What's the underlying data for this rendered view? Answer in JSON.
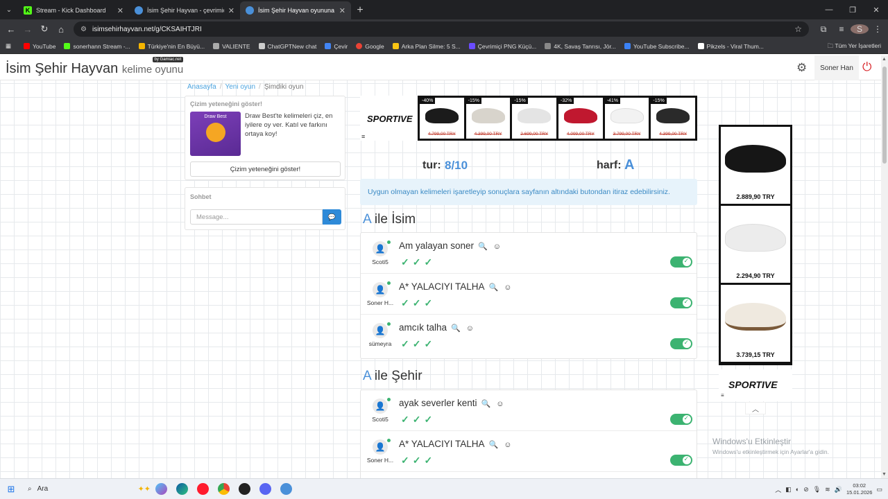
{
  "browser": {
    "tabs": [
      {
        "title": "Stream - Kick Dashboard",
        "icon": "kick-icon",
        "active": false
      },
      {
        "title": "İsim Şehir Hayvan - çevrimiçi oy",
        "icon": "globe-icon",
        "active": false
      },
      {
        "title": "İsim Şehir Hayvan oyununa katı",
        "icon": "globe-icon",
        "active": true
      }
    ],
    "url": "isimsehirhayvan.net/g/CKSAIHTJRI",
    "profile_initial": "S",
    "bookmarks": [
      {
        "label": "YouTube",
        "color": "#ff0000"
      },
      {
        "label": "sonerhann Stream -...",
        "color": "#53fc18"
      },
      {
        "label": "Türkiye'nin En Büyü...",
        "color": "#f4b400"
      },
      {
        "label": "VALIENTE",
        "color": "#aaaaaa"
      },
      {
        "label": "ChatGPTNew chat",
        "color": "#cccccc"
      },
      {
        "label": "Çevir",
        "color": "#4285f4"
      },
      {
        "label": "Google",
        "color": "#ea4335"
      },
      {
        "label": "Arka Plan Silme: 5 S...",
        "color": "#f9c513"
      },
      {
        "label": "Çevrimiçi PNG Küçü...",
        "color": "#6a4cff"
      },
      {
        "label": "4K, Savaş Tanrısı, Jör...",
        "color": "#888888"
      },
      {
        "label": "YouTube Subscribe...",
        "color": "#3b82f6"
      },
      {
        "label": "Pikzels - Viral Thum...",
        "color": "#ffffff"
      }
    ],
    "all_bookmarks": "Tüm Yer İşaretleri"
  },
  "site": {
    "logo": "İsim Şehir Hayvan",
    "logo_sub": "kelime oyunu",
    "logo_badge": "by Gamiac.net",
    "username": "Soner Han"
  },
  "breadcrumb": [
    "Anasayfa",
    "Yeni oyun",
    "Şimdiki oyun"
  ],
  "draw_panel": {
    "title": "Çizim yeteneğini göster!",
    "image_text": "Draw Best",
    "text": "Draw Best'te kelimeleri çiz, en iyilere oy ver. Katıl ve farkını ortaya koy!",
    "button": "Çizim yeteneğini göster!"
  },
  "chat_panel": {
    "title": "Sohbet",
    "placeholder": "Message..."
  },
  "ad_banner": {
    "brand": "SPORTIVE",
    "items": [
      {
        "discount": "-40%",
        "price": "4.799,00 TRY",
        "shoe_color": "#1b1b1b"
      },
      {
        "discount": "-15%",
        "price": "4.399,00 TRY",
        "shoe_color": "#d8d4cc"
      },
      {
        "discount": "-15%",
        "price": "2.699,00 TRY",
        "shoe_color": "#e4e4e4"
      },
      {
        "discount": "-32%",
        "price": "4.099,00 TRY",
        "shoe_color": "#c0182f"
      },
      {
        "discount": "-41%",
        "price": "3.799,00 TRY",
        "shoe_color": "#f2f2f2"
      },
      {
        "discount": "-15%",
        "price": "4.399,00 TRY",
        "shoe_color": "#2a2a2a"
      }
    ]
  },
  "game": {
    "round_label": "tur:",
    "round_value": "8/10",
    "letter_label": "harf:",
    "letter_value": "A",
    "info": "Uygun olmayan kelimeleri işaretleyip sonuçlara sayfanın altındaki butondan itiraz edebilirsiniz."
  },
  "categories": [
    {
      "letter": "A",
      "name": "ile İsim",
      "answers": [
        {
          "user": "Scoti5",
          "word": "Am yalayan soner"
        },
        {
          "user": "Soner H...",
          "word": "A* YALACIYI TALHA"
        },
        {
          "user": "sümeyra",
          "word": "amcık talha"
        }
      ]
    },
    {
      "letter": "A",
      "name": "ile Şehir",
      "answers": [
        {
          "user": "Scoti5",
          "word": "ayak severler kenti"
        },
        {
          "user": "Soner H...",
          "word": "A* YALACIYI TALHA"
        }
      ]
    }
  ],
  "side_ad": {
    "brand": "SPORTIVE",
    "items": [
      {
        "price": "2.889,90 TRY",
        "shoe_color": "#161616"
      },
      {
        "price": "2.294,90 TRY",
        "shoe_color": "#ececec"
      },
      {
        "price": "3.739,15 TRY",
        "shoe_color": "#efe9df"
      }
    ]
  },
  "watermark": {
    "title": "Windows'u Etkinleştir",
    "subtitle": "Windows'u etkinleştirmek için Ayarlar'a gidin."
  },
  "taskbar": {
    "search": "Ara",
    "time": "03:02",
    "date": "15.01.2026"
  }
}
